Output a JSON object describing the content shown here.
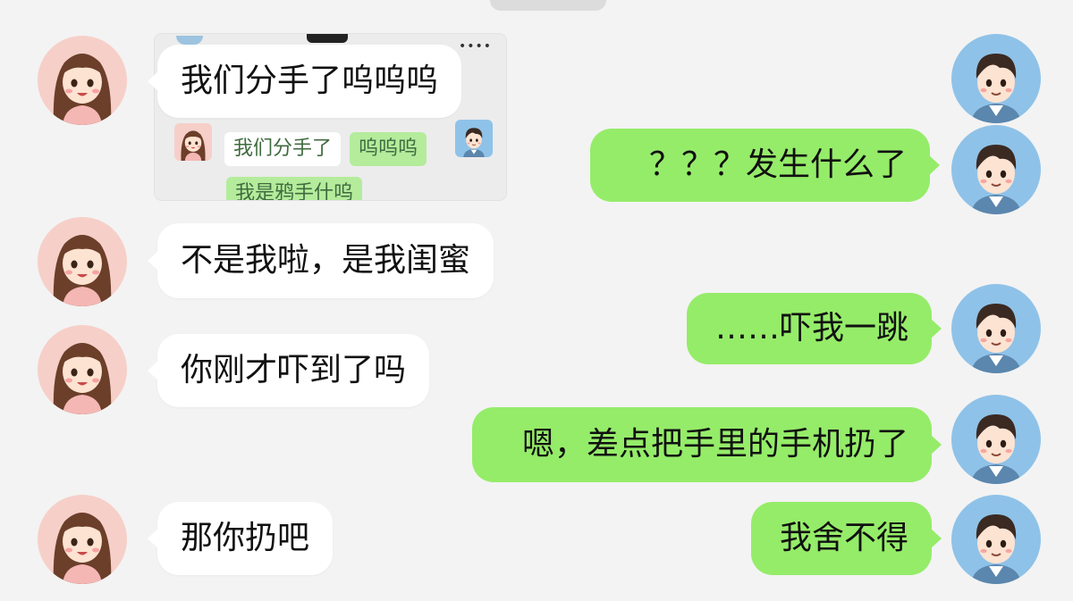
{
  "theme": {
    "background": "#f3f3f3",
    "left_bubble": "#ffffff",
    "right_bubble": "#95ec69"
  },
  "embedded_screenshot": {
    "line1_part1": "我们分手了",
    "line1_part2": "呜呜呜",
    "line2": "我是鸦手什呜",
    "menu_icon": "more-dots-icon"
  },
  "messages": [
    {
      "side": "left",
      "sender": "girl-avatar",
      "text": "我们分手了呜呜呜"
    },
    {
      "side": "right",
      "sender": "boy-avatar",
      "text": "？？？发生什么了"
    },
    {
      "side": "left",
      "sender": "girl-avatar",
      "text": "不是我啦，是我闺蜜"
    },
    {
      "side": "right",
      "sender": "boy-avatar",
      "text": "……吓我一跳"
    },
    {
      "side": "left",
      "sender": "girl-avatar",
      "text": "你刚才吓到了吗"
    },
    {
      "side": "right",
      "sender": "boy-avatar",
      "text": "嗯，差点把手里的手机扔了"
    },
    {
      "side": "left",
      "sender": "girl-avatar",
      "text": "那你扔吧"
    },
    {
      "side": "right",
      "sender": "boy-avatar",
      "text": "我舍不得"
    }
  ]
}
